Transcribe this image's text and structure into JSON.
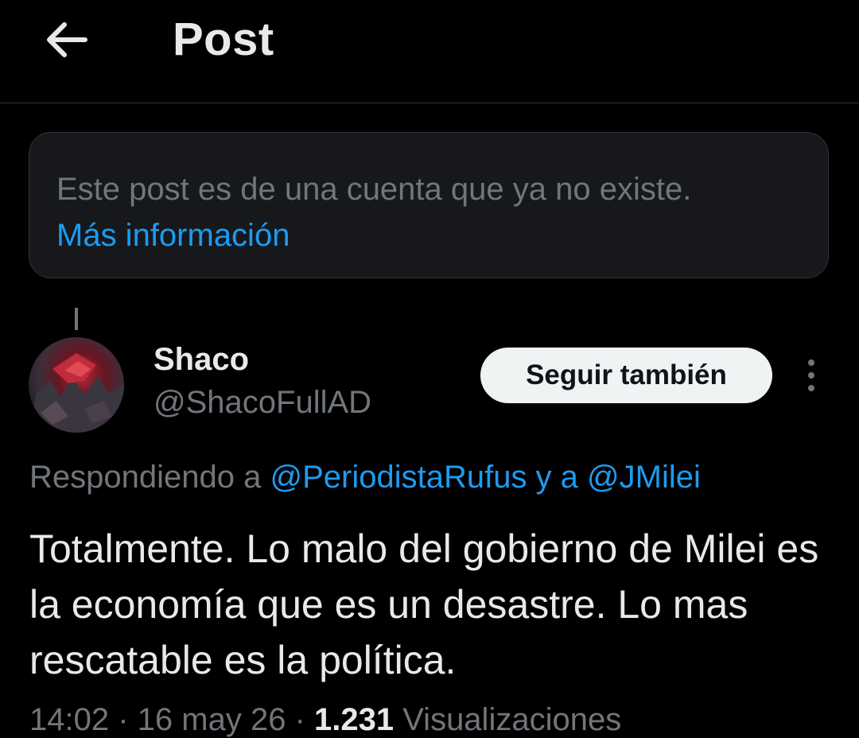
{
  "header": {
    "title": "Post",
    "back_icon": "arrow-left-icon"
  },
  "notice": {
    "text": "Este post es de una cuenta que ya no existe.",
    "link": "Más información"
  },
  "author": {
    "name": "Shaco",
    "handle": "@ShacoFullAD",
    "follow_label": "Seguir también"
  },
  "reply": {
    "prefix": "Respondiendo a ",
    "mention_1": "@PeriodistaRufus",
    "connector": " y a ",
    "mention_2": "@JMilei"
  },
  "post": {
    "text": "Totalmente. Lo malo del gobierno de Milei es la economía que es un desastre. Lo mas rescatable es la política."
  },
  "meta": {
    "time": "14:02",
    "date": "16 may 26",
    "views_count": "1.231",
    "views_label": "Visualizaciones",
    "separator": " · "
  },
  "colors": {
    "accent": "#1d9bf0",
    "background": "#000000",
    "muted": "#71767b",
    "text": "#e7e9ea"
  }
}
